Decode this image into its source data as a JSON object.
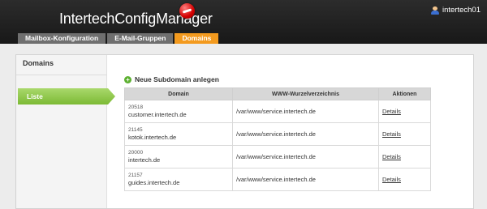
{
  "app": {
    "title": "IntertechConfigManager",
    "user": "intertech01"
  },
  "tabs": [
    {
      "label": "Mailbox-Konfiguration",
      "active": false
    },
    {
      "label": "E-Mail-Gruppen",
      "active": false
    },
    {
      "label": "Domains",
      "active": true
    }
  ],
  "sidebar": {
    "title": "Domains",
    "items": [
      {
        "label": "Liste",
        "active": true
      }
    ]
  },
  "main": {
    "heading": "Neue Subdomain anlegen",
    "table": {
      "headers": [
        "Domain",
        "WWW-Wurzelverzeichnis",
        "Aktionen"
      ],
      "rows": [
        {
          "id": "20518",
          "domain": "customer.intertech.de",
          "path": "/var/www/service.intertech.de",
          "action": "Details"
        },
        {
          "id": "21145",
          "domain": "kotok.intertech.de",
          "path": "/var/www/service.intertech.de",
          "action": "Details"
        },
        {
          "id": "20000",
          "domain": "intertech.de",
          "path": "/var/www/service.intertech.de",
          "action": "Details"
        },
        {
          "id": "21157",
          "domain": "guides.intertech.de",
          "path": "/var/www/service.intertech.de",
          "action": "Details"
        }
      ]
    }
  },
  "colors": {
    "topbar": "#1f1f1f",
    "tab": "#6f6f6f",
    "tab_active": "#f39a1e",
    "nav_active": "#8cc63f"
  }
}
